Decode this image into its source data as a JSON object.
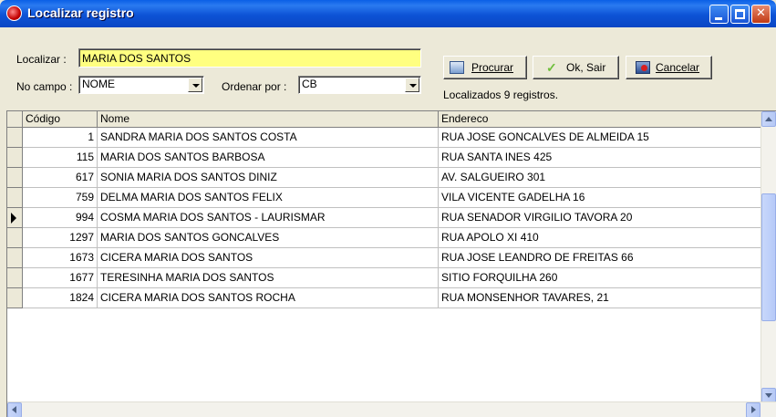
{
  "window": {
    "title": "Localizar registro"
  },
  "form": {
    "search_label": "Localizar :",
    "search_value": "MARIA DOS SANTOS",
    "field_label": "No campo :",
    "field_value": "NOME",
    "order_label": "Ordenar por :",
    "order_value": "CB"
  },
  "toolbar": {
    "search_button": "Procurar",
    "ok_button": "Ok, Sair",
    "cancel_button": "Cancelar"
  },
  "status": "Localizados 9 registros.",
  "table": {
    "columns": [
      "Código",
      "Nome",
      "Endereco"
    ],
    "rows": [
      [
        "1",
        "SANDRA MARIA DOS SANTOS COSTA",
        "RUA JOSE GONCALVES DE ALMEIDA 15"
      ],
      [
        "115",
        "MARIA DOS SANTOS BARBOSA",
        "RUA SANTA INES 425"
      ],
      [
        "617",
        "SONIA MARIA DOS SANTOS DINIZ",
        "AV. SALGUEIRO 301"
      ],
      [
        "759",
        "DELMA MARIA DOS SANTOS FELIX",
        "VILA VICENTE GADELHA 16"
      ],
      [
        "994",
        "COSMA MARIA DOS SANTOS - LAURISMAR",
        "RUA SENADOR VIRGILIO TAVORA 20"
      ],
      [
        "1297",
        "MARIA DOS SANTOS GONCALVES",
        "RUA APOLO XI 410"
      ],
      [
        "1673",
        "CICERA MARIA DOS SANTOS",
        "RUA JOSE LEANDRO DE FREITAS 66"
      ],
      [
        "1677",
        "TERESINHA MARIA DOS SANTOS",
        "SITIO FORQUILHA 260"
      ],
      [
        "1824",
        "CICERA MARIA DOS SANTOS ROCHA",
        "RUA MONSENHOR TAVARES, 21"
      ]
    ],
    "current_row": 4
  }
}
